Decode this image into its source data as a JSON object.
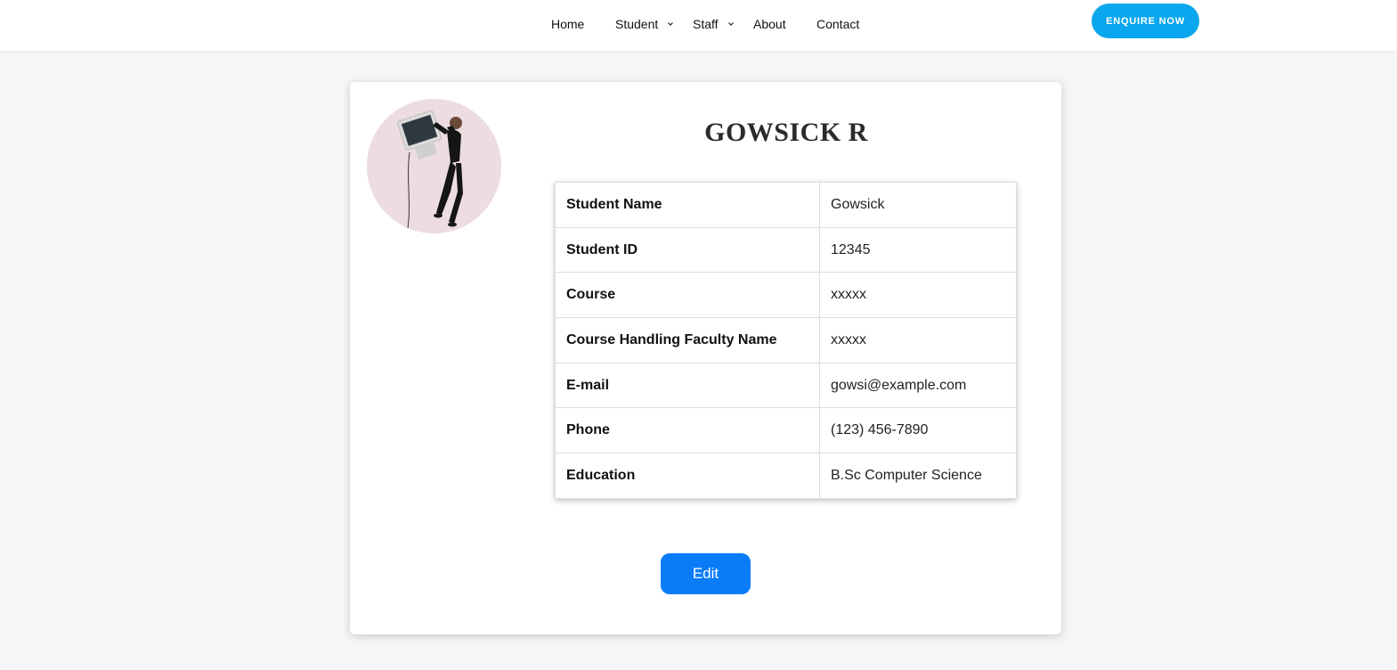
{
  "nav": {
    "items": [
      {
        "label": "Home",
        "dropdown": false
      },
      {
        "label": "Student",
        "dropdown": true
      },
      {
        "label": "Staff",
        "dropdown": true
      },
      {
        "label": "About",
        "dropdown": false
      },
      {
        "label": "Contact",
        "dropdown": false
      }
    ],
    "cta_label": "ENQUIRE NOW"
  },
  "profile": {
    "name": "GOWSICK R",
    "avatar_icon": "profile-photo",
    "details": [
      {
        "label": "Student Name",
        "value": "Gowsick"
      },
      {
        "label": "Student ID",
        "value": "12345"
      },
      {
        "label": "Course",
        "value": "xxxxx"
      },
      {
        "label": "Course Handling Faculty Name",
        "value": "xxxxx"
      },
      {
        "label": "E-mail",
        "value": "gowsi@example.com"
      },
      {
        "label": "Phone",
        "value": "(123) 456-7890"
      },
      {
        "label": "Education",
        "value": "B.Sc Computer Science"
      }
    ],
    "edit_label": "Edit"
  },
  "colors": {
    "accent_enquire": "#0aa6ee",
    "accent_edit": "#0a7cf8",
    "page_bg": "#f5f6f8"
  }
}
